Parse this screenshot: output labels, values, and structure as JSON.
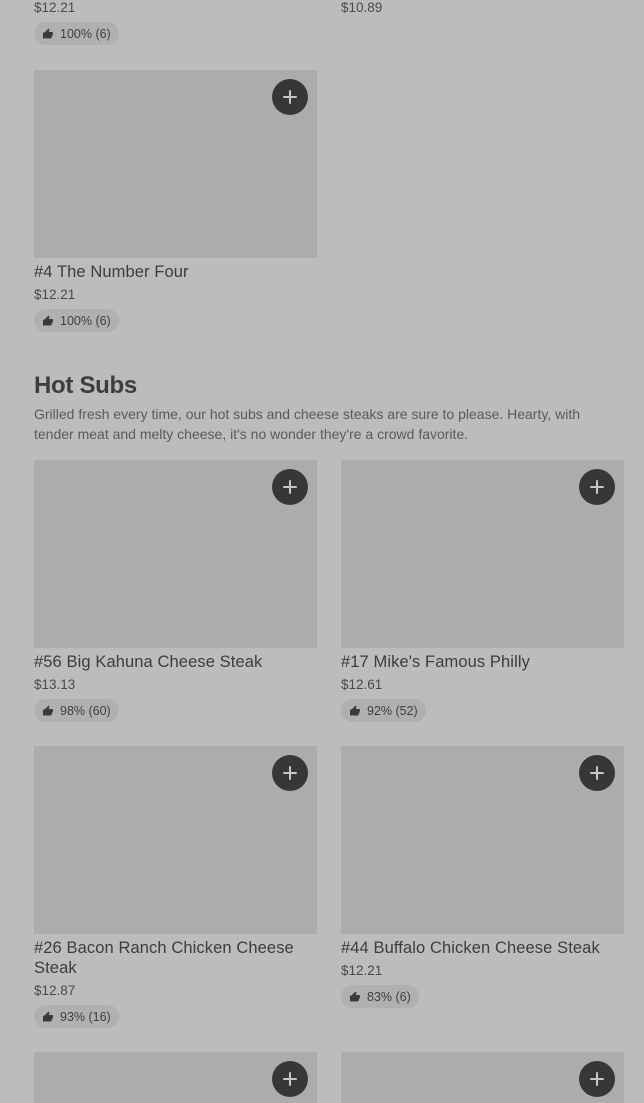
{
  "top_partial": {
    "left": {
      "price": "$12.21",
      "rating": "100% (6)"
    },
    "right": {
      "price": "$10.89"
    }
  },
  "items_top": [
    {
      "name": "#4 The Number Four",
      "price": "$12.21",
      "rating": "100% (6)"
    }
  ],
  "section": {
    "title": "Hot Subs",
    "description": "Grilled fresh every time, our hot subs and cheese steaks are sure to please. Hearty, with tender meat and melty cheese, it's no wonder they're a crowd favorite."
  },
  "hot_subs": [
    {
      "name": "#56 Big Kahuna Cheese Steak",
      "price": "$13.13",
      "rating": "98% (60)"
    },
    {
      "name": "#17 Mike's Famous Philly",
      "price": "$12.61",
      "rating": "92% (52)"
    },
    {
      "name": "#26 Bacon Ranch Chicken Cheese Steak",
      "price": "$12.87",
      "rating": "93% (16)"
    },
    {
      "name": "#44 Buffalo Chicken Cheese Steak",
      "price": "$12.21",
      "rating": "83% (6)"
    }
  ],
  "icons": {
    "add": "plus-icon",
    "rating": "thumbs-up-icon"
  },
  "colors": {
    "background": "#bcbcbc",
    "image_placeholder": "#acacac",
    "add_button": "#373737"
  }
}
